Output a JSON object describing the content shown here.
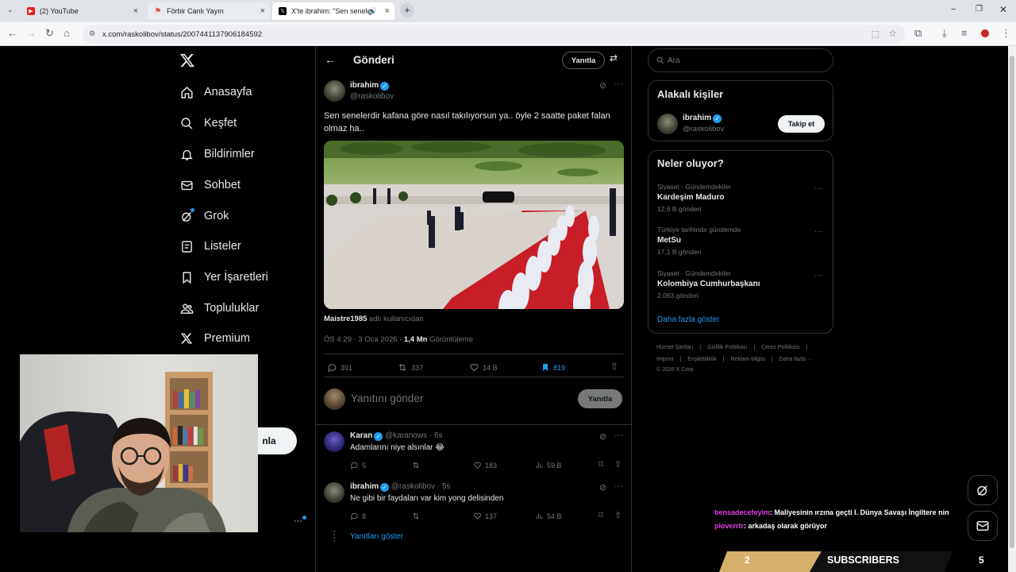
{
  "browser": {
    "tabs": [
      {
        "title": "(2) YouTube",
        "active": false
      },
      {
        "title": "Förbir Canlı Yayın",
        "active": false
      },
      {
        "title": "X'te ibrahim: \"Sen senelerdi",
        "active": true
      }
    ],
    "url": "x.com/raskolibov/status/2007441137906184592"
  },
  "nav": {
    "items": [
      {
        "label": "Anasayfa",
        "icon": "home-icon"
      },
      {
        "label": "Keşfet",
        "icon": "search-icon"
      },
      {
        "label": "Bildirimler",
        "icon": "bell-icon"
      },
      {
        "label": "Sohbet",
        "icon": "mail-icon"
      },
      {
        "label": "Grok",
        "icon": "grok-icon"
      },
      {
        "label": "Listeler",
        "icon": "list-icon"
      },
      {
        "label": "Yer İşaretleri",
        "icon": "bookmark-icon"
      },
      {
        "label": "Topluluklar",
        "icon": "people-icon"
      },
      {
        "label": "Premium",
        "icon": "x-icon"
      }
    ],
    "post_button_partial": "nla",
    "more_glyph": "···"
  },
  "header": {
    "title": "Gönderi",
    "reply_button": "Yanıtla"
  },
  "tweet": {
    "author_name": "ibrahim",
    "author_handle": "@raskolibov",
    "text": "Sen senelerdir kafana göre nasıl takılıyorsun ya.. öyle 2 saatte paket falan olmaz ha..",
    "image_credit_name": "Maistre1985",
    "image_credit_suffix": "adlı kullanıcıdan",
    "timestamp": "ÖS 4:29 · 3 Oca 2026 ·",
    "views_count": "1,4 Mn",
    "views_label": "Görüntüleme",
    "replies": "391",
    "retweets": "337",
    "likes": "14 B",
    "bookmarks": "819"
  },
  "composer": {
    "placeholder": "Yanıtını gönder",
    "button": "Yanıtla"
  },
  "replies": [
    {
      "name": "Karan",
      "handle": "@karanows",
      "time": "· 6s",
      "text": "Adamlarını niye alsınlar 😂",
      "replies": "5",
      "retweets": "",
      "likes": "183",
      "views": "59 B"
    },
    {
      "name": "ibrahim",
      "handle": "@raskolibov",
      "time": "· 5s",
      "text": "Ne gibi bir faydaları var kim yong delisinden",
      "replies": "8",
      "retweets": "",
      "likes": "137",
      "views": "54 B"
    }
  ],
  "show_replies": "Yanıtları göster",
  "search": {
    "placeholder": "Ara"
  },
  "related": {
    "title": "Alakalı kişiler",
    "name": "ibrahim",
    "handle": "@raskolibov",
    "follow": "Takip et"
  },
  "trends": {
    "title": "Neler oluyor?",
    "items": [
      {
        "meta": "Siyaset · Gündemdekiler",
        "name": "Kardeşim Maduro",
        "count": "12,6 B gönderi"
      },
      {
        "meta": "Türkiye tarihinde gündemde",
        "name": "MetSu",
        "count": "17,1 B gönderi"
      },
      {
        "meta": "Siyaset · Gündemdekiler",
        "name": "Kolombiya Cumhurbaşkanı",
        "count": "2.063 gönderi"
      }
    ],
    "show_more": "Daha fazla göster"
  },
  "footer": {
    "line1": [
      "Hizmet Şartları",
      "|",
      "Gizlilik Politikası",
      "|",
      "Çerez Politikası",
      "|"
    ],
    "line2": [
      "Imprint",
      "|",
      "Erişilebilirlik",
      "|",
      "Reklam bilgisi",
      "|",
      "Daha fazla ···"
    ],
    "copyright": "© 2026 X Corp."
  },
  "overlay": {
    "chat": [
      {
        "user": "bensadecefeyim",
        "message": ": Maliyesinin ırzına geçti I. Dünya Savaşı İngiltere nin",
        "color": "#e040e0"
      },
      {
        "user": "ploverrtr",
        "message": ": arkadaş olarak görüyor",
        "color": "#e040e0"
      }
    ],
    "subs_left": "2",
    "subs_label": "SUBSCRIBERS",
    "subs_right": "5"
  },
  "colors": {
    "accent": "#1d9bf0",
    "background": "#000000",
    "border": "#2f3336",
    "muted": "#71767b"
  }
}
